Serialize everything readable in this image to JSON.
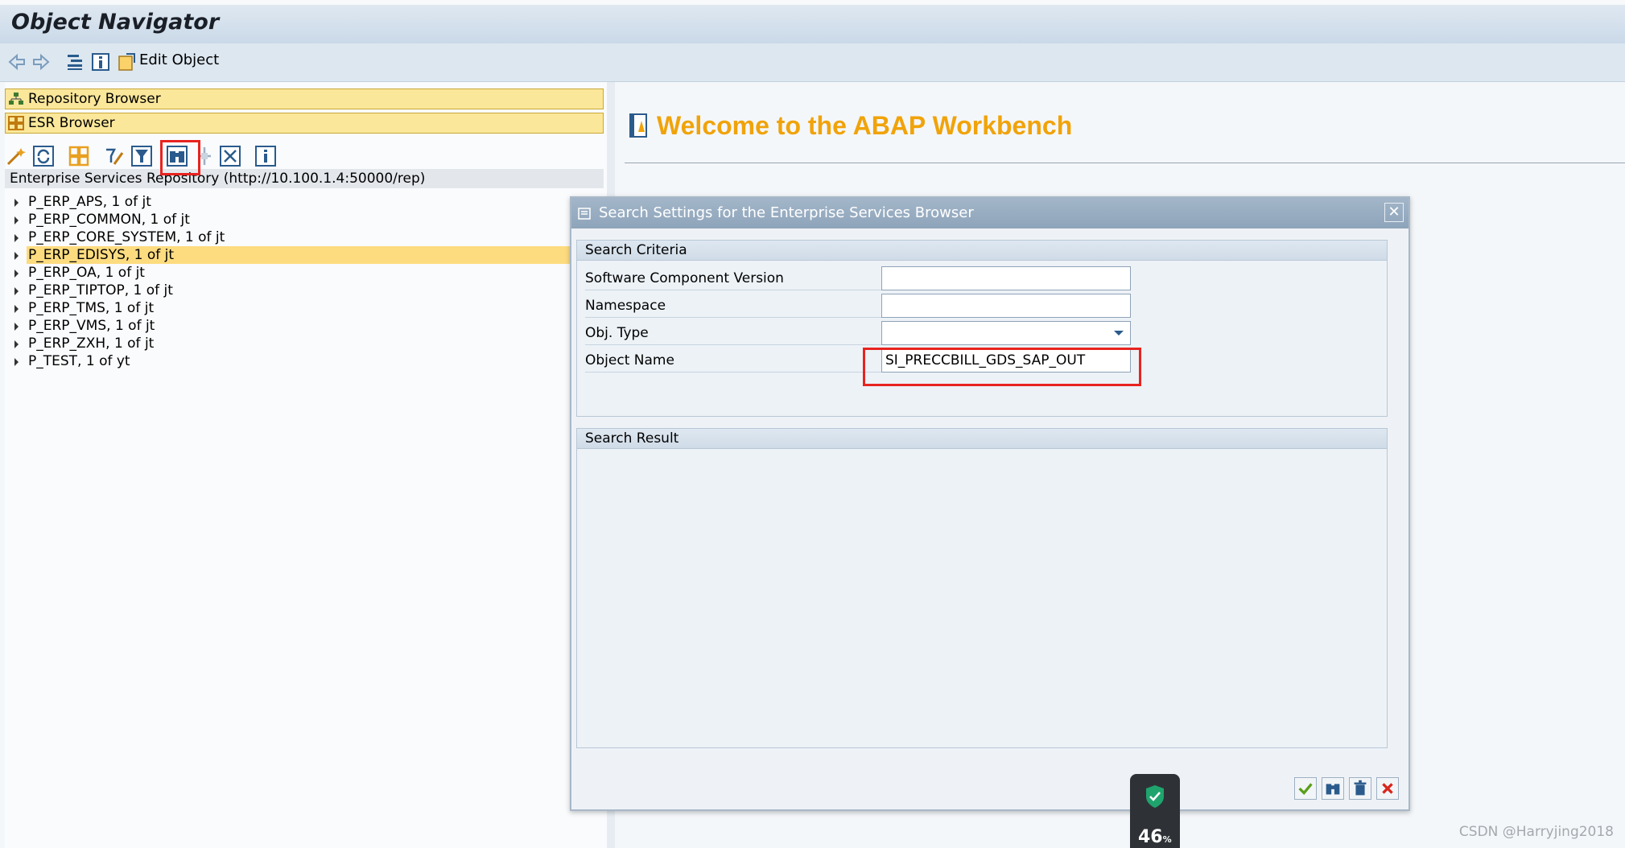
{
  "window": {
    "title": "Object Navigator"
  },
  "toolbar": {
    "edit_object_label": "Edit Object"
  },
  "left": {
    "repository_browser": "Repository Browser",
    "esr_browser": "ESR Browser",
    "repo_header": "Enterprise Services Repository (http://10.100.1.4:50000/rep)",
    "tree": [
      "P_ERP_APS, 1 of jt",
      "P_ERP_COMMON, 1 of jt",
      "P_ERP_CORE_SYSTEM, 1 of jt",
      "P_ERP_EDISYS, 1 of jt",
      "P_ERP_OA, 1 of jt",
      "P_ERP_TIPTOP, 1 of jt",
      "P_ERP_TMS, 1 of jt",
      "P_ERP_VMS, 1 of jt",
      "P_ERP_ZXH, 1 of jt",
      "P_TEST, 1 of yt"
    ],
    "selected_index": 3
  },
  "right": {
    "welcome": "Welcome to the ABAP Workbench"
  },
  "dialog": {
    "title": "Search Settings for the Enterprise Services Browser",
    "close": "✕",
    "criteria_header": "Search Criteria",
    "rows": [
      {
        "label": "Software Component Version",
        "value": ""
      },
      {
        "label": "Namespace",
        "value": ""
      },
      {
        "label": "Obj. Type",
        "value": ""
      },
      {
        "label": "Object Name",
        "value": "SI_PRECCBILL_GDS_SAP_OUT"
      }
    ],
    "result_header": "Search Result"
  },
  "overlay": {
    "percent": "46",
    "percent_unit": "%"
  },
  "watermark": "CSDN @Harryjing2018",
  "colors": {
    "accent_orange": "#f0a30a",
    "highlight_red": "#e8231f",
    "selection_yellow": "#fddc80"
  }
}
